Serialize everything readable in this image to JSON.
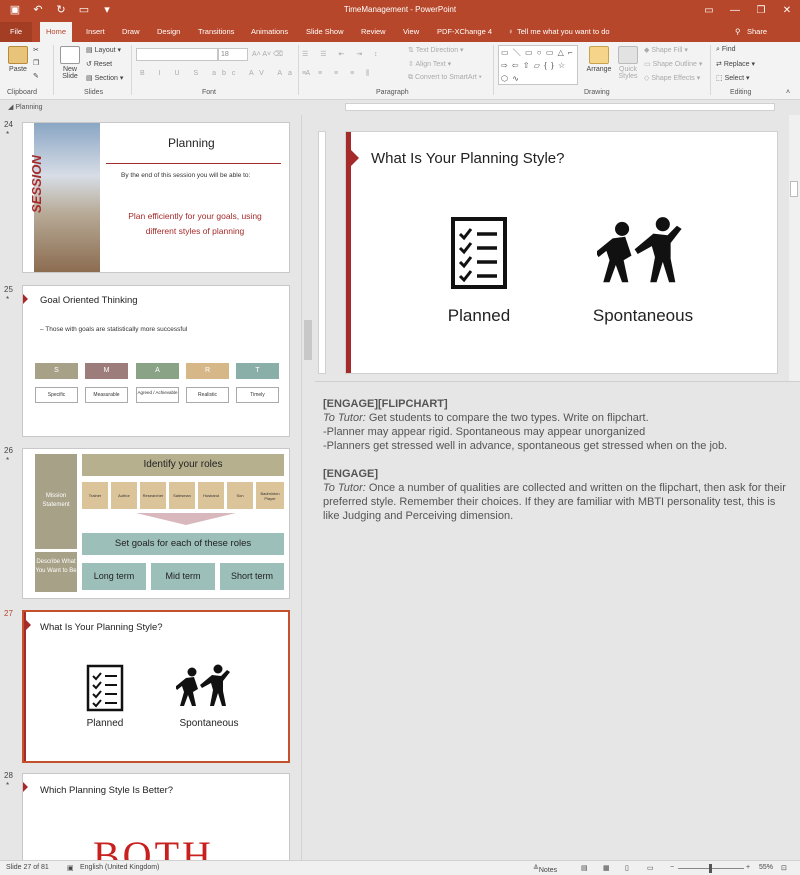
{
  "window": {
    "title": "TimeManagement - PowerPoint",
    "share_label": "Share"
  },
  "tabs": [
    "File",
    "Home",
    "Insert",
    "Draw",
    "Design",
    "Transitions",
    "Animations",
    "Slide Show",
    "Review",
    "View",
    "PDF-XChange 4"
  ],
  "tell_me": "Tell me what you want to do",
  "ribbon": {
    "clipboard": {
      "paste": "Paste",
      "group": "Clipboard"
    },
    "slides": {
      "new_slide": "New Slide",
      "layout": "Layout",
      "reset": "Reset",
      "section": "Section",
      "group": "Slides"
    },
    "font": {
      "size": "18",
      "group": "Font"
    },
    "paragraph": {
      "text_direction": "Text Direction",
      "align_text": "Align Text",
      "convert_smartart": "Convert to SmartArt",
      "group": "Paragraph"
    },
    "drawing": {
      "arrange": "Arrange",
      "quick_styles": "Quick Styles",
      "shape_fill": "Shape Fill",
      "shape_outline": "Shape Outline",
      "shape_effects": "Shape Effects",
      "group": "Drawing"
    },
    "editing": {
      "find": "Find",
      "replace": "Replace",
      "select": "Select",
      "group": "Editing"
    }
  },
  "section_name": "Planning",
  "thumbnails": {
    "s24": {
      "number": "24",
      "title": "Planning",
      "side_text": "SESSION",
      "subtitle": "By the end of this session you will be able to:",
      "objective": "Plan efficiently for your goals, using different styles of planning"
    },
    "s25": {
      "number": "25",
      "title": "Goal Oriented Thinking",
      "bullet": "– Those with goals are statistically more successful",
      "smart_letters": [
        "S",
        "M",
        "A",
        "R",
        "T"
      ],
      "smart_words": [
        "Specific",
        "Measurable",
        "Agreed / Achievable",
        "Realistic",
        "Timely"
      ]
    },
    "s26": {
      "number": "26",
      "mission": "Mission Statement",
      "describe": "Describe What You Want to Be",
      "roles_title": "Identify your roles",
      "roles": [
        "Trainer",
        "Author",
        "Researcher",
        "Salesman",
        "Husband",
        "Son",
        "Badminton Player"
      ],
      "goals_title": "Set goals for each of these roles",
      "terms": [
        "Long term",
        "Mid term",
        "Short term"
      ]
    },
    "s27": {
      "number": "27",
      "title": "What Is Your Planning Style?",
      "left_label": "Planned",
      "right_label": "Spontaneous"
    },
    "s28": {
      "number": "28",
      "title": "Which Planning Style Is Better?",
      "big_word": "BOTH"
    }
  },
  "main_slide": {
    "title": "What Is Your Planning Style?",
    "left_label": "Planned",
    "right_label": "Spontaneous"
  },
  "notes": {
    "b1_head": "[ENGAGE][FLIPCHART]",
    "b1_prefix": "To Tutor:",
    "b1_line1": " Get students to compare the two types.  Write on flipchart.",
    "b1_line2": "-Planner may appear rigid. Spontaneous may appear unorganized",
    "b1_line3": "-Planners get stressed well in advance, spontaneous get stressed when on the job.",
    "b2_head": "[ENGAGE]",
    "b2_prefix": "To Tutor:",
    "b2_text": " Once a number of qualities are collected and written on the flipchart, then ask for their preferred style. Remember their choices. If they are familiar with MBTI personality test, this is like Judging and Perceiving dimension."
  },
  "status": {
    "slide_count": "Slide 27 of 81",
    "language": "English (United Kingdom)",
    "notes": "Notes",
    "zoom": "55%"
  },
  "colors": {
    "accent": "#b7472a",
    "slide_red": "#a52a2a"
  }
}
